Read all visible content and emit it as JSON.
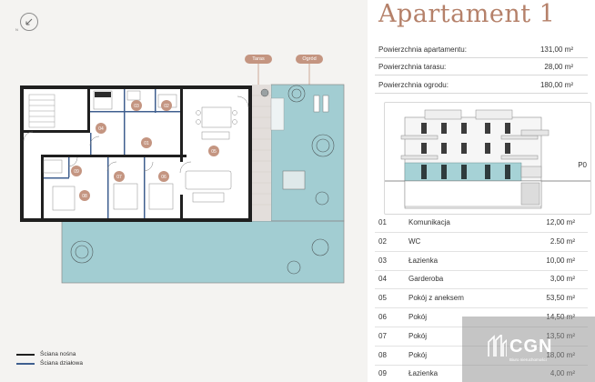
{
  "title": "Apartament 1",
  "summary": [
    {
      "label": "Powierzchnia apartamentu:",
      "value": "131,00 m²"
    },
    {
      "label": "Powierzchnia tarasu:",
      "value": "28,00 m²"
    },
    {
      "label": "Powierzchnia ogrodu:",
      "value": "180,00 m²"
    }
  ],
  "elevation": {
    "level_label": "P0"
  },
  "rooms": [
    {
      "num": "01",
      "name": "Komunikacja",
      "area": "12,00 m²"
    },
    {
      "num": "02",
      "name": "WC",
      "area": "2.50 m²"
    },
    {
      "num": "03",
      "name": "Łazienka",
      "area": "10,00 m²"
    },
    {
      "num": "04",
      "name": "Garderoba",
      "area": "3,00 m²"
    },
    {
      "num": "05",
      "name": "Pokój z aneksem",
      "area": "53,50 m²"
    },
    {
      "num": "06",
      "name": "Pokój",
      "area": "14,50 m²"
    },
    {
      "num": "07",
      "name": "Pokój",
      "area": "13,50 m²"
    },
    {
      "num": "08",
      "name": "Pokój",
      "area": "18,00 m²"
    },
    {
      "num": "09",
      "name": "Łazienka",
      "area": "4,00 m²"
    }
  ],
  "plan": {
    "tag_terrace": "Taras",
    "tag_garden": "Ogród",
    "room_markers": [
      "01",
      "02",
      "03",
      "04",
      "05",
      "06",
      "07",
      "08",
      "09"
    ],
    "compass_letter": "N"
  },
  "legend": [
    {
      "label": "Ściana nośna",
      "color": "#1f1f1f"
    },
    {
      "label": "Ściana działowa",
      "color": "#3f5f8f"
    }
  ],
  "watermark": {
    "text": "CGN",
    "subtext": "Biuro nieruchomości"
  },
  "colors": {
    "accent": "#b5816a",
    "marker": "#c49581",
    "garden": "#9ccbd1",
    "wall": "#1f1f1f"
  }
}
